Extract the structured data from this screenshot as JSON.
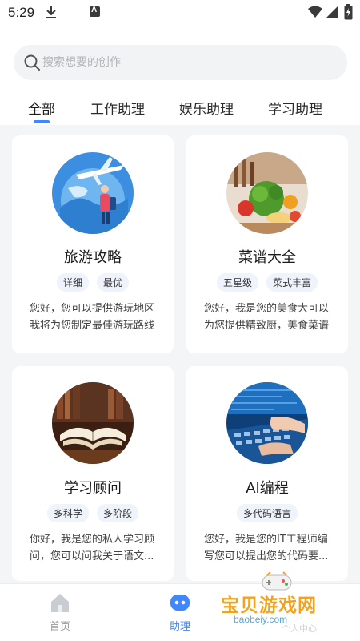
{
  "status_bar": {
    "time": "5:29"
  },
  "search": {
    "placeholder": "搜索想要的创作"
  },
  "tabs": [
    {
      "label": "全部",
      "active": true
    },
    {
      "label": "工作助理",
      "active": false
    },
    {
      "label": "娱乐助理",
      "active": false
    },
    {
      "label": "学习助理",
      "active": false
    }
  ],
  "cards": [
    {
      "title": "旅游攻略",
      "tags": [
        "详细",
        "最优"
      ],
      "desc": "您好，您可以提供游玩地区我将为您制定最佳游玩路线",
      "image": "travel-illustration"
    },
    {
      "title": "菜谱大全",
      "tags": [
        "五星级",
        "菜式丰富"
      ],
      "desc": "您好，我是您的美食大可以为您提供精致厨，美食菜谱",
      "image": "vegetables-photo"
    },
    {
      "title": "学习顾问",
      "tags": [
        "多科学",
        "多阶段"
      ],
      "desc": "你好，我是您的私人学习顾问，您可以问我关于语文...",
      "image": "open-book-photo"
    },
    {
      "title": "AI编程",
      "tags": [
        "多代码语言"
      ],
      "desc": "您好，我是您的IT工程师编写您可以提出您的代码要...",
      "image": "keyboard-typing-photo"
    }
  ],
  "bottom_nav": [
    {
      "label": "首页",
      "icon": "home-icon",
      "active": false
    },
    {
      "label": "助理",
      "icon": "assistant-icon",
      "active": true
    }
  ],
  "watermark": {
    "text": "宝贝游戏网",
    "url": "baobeiy.com",
    "sub": "个人中心"
  },
  "colors": {
    "accent": "#3f86ff",
    "tag_bg": "#eef3fc",
    "page_bg": "#f4f5f7"
  }
}
